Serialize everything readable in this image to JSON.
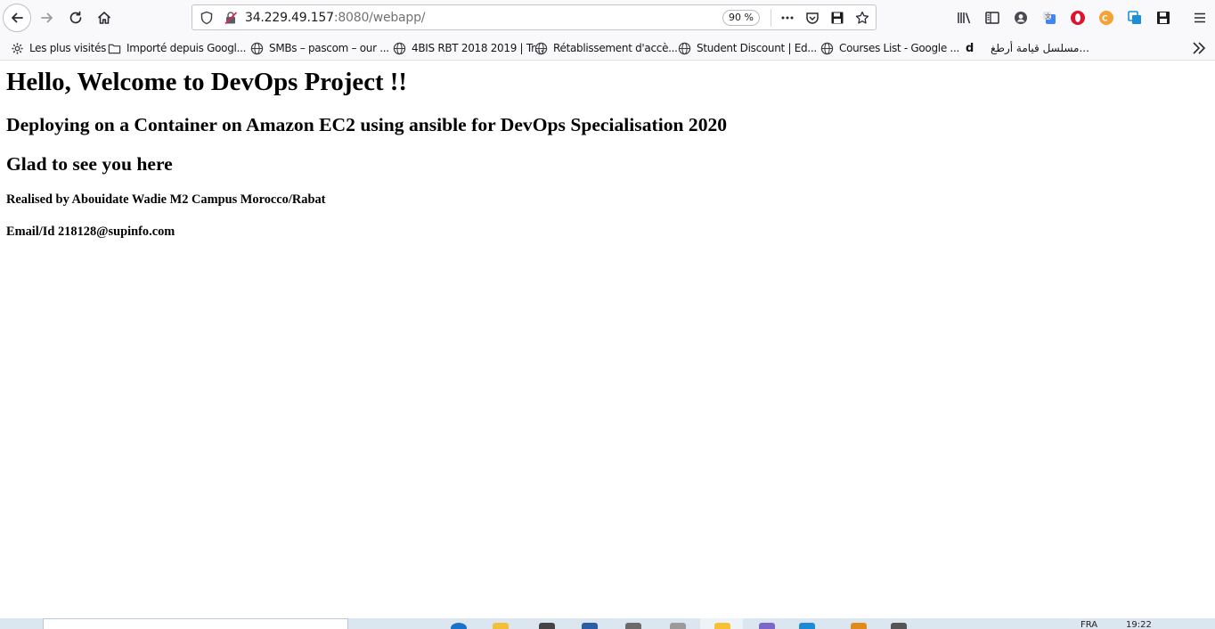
{
  "toolbar": {
    "url_host": "34.229.49.157",
    "url_rest": ":8080/webapp/",
    "zoom": "90 %"
  },
  "bookmarks": [
    {
      "label": "Les plus visités",
      "icon": "gear-icon"
    },
    {
      "label": "Importé depuis Googl...",
      "icon": "folder-icon"
    },
    {
      "label": "SMBs – pascom – our ...",
      "icon": "globe-icon"
    },
    {
      "label": "4BIS RBT 2018 2019 | Tr...",
      "icon": "globe-icon"
    },
    {
      "label": "Rétablissement d'accè...",
      "icon": "globe-icon"
    },
    {
      "label": "Student Discount | Ed...",
      "icon": "globe-icon"
    },
    {
      "label": "Courses List - Google ...",
      "icon": "globe-icon"
    },
    {
      "label": "d",
      "icon": "none"
    },
    {
      "label": "مسلسل قيامة أرطغ...",
      "icon": "none"
    }
  ],
  "page": {
    "h1": "Hello, Welcome to DevOps Project !!",
    "h2": "Deploying on a Container on Amazon EC2 using ansible for DevOps Specialisation 2020",
    "h3": "Glad to see you here",
    "realised": "Realised by Abouidate Wadie M2 Campus Morocco/Rabat",
    "email": "Email/Id 218128@supinfo.com"
  },
  "taskbar": {
    "lang": "FRA",
    "time": "19:22"
  },
  "colors": {
    "toolbar_bg": "#f9f9fb",
    "text": "#000000",
    "taskbar_bg": "#dce6f0"
  }
}
